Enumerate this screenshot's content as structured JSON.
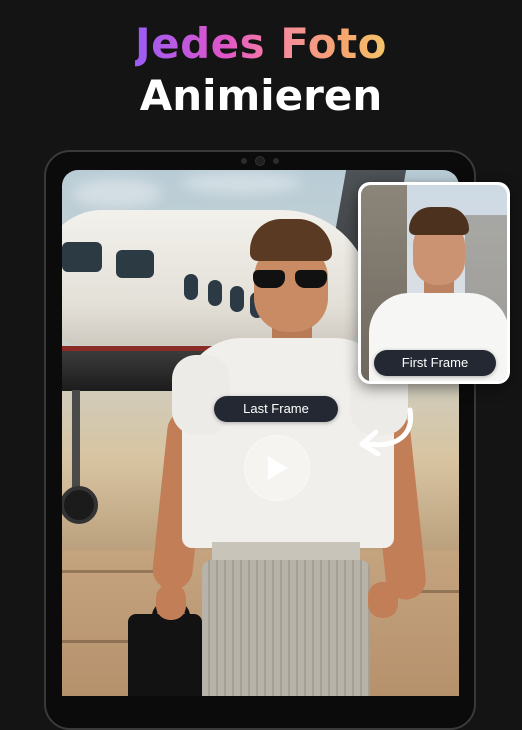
{
  "headline": {
    "word1": "Jedes",
    "word2": "Foto",
    "line2": "Animieren"
  },
  "labels": {
    "last_frame": "Last Frame",
    "first_frame": "First Frame"
  },
  "icons": {
    "play": "play-icon",
    "arrow": "curved-arrow-icon"
  },
  "colors": {
    "background": "#141414",
    "gradient_start": "#9b5cf6",
    "gradient_mid": "#e056c8",
    "gradient_end": "#f4c56a",
    "pill_bg": "#232833"
  }
}
